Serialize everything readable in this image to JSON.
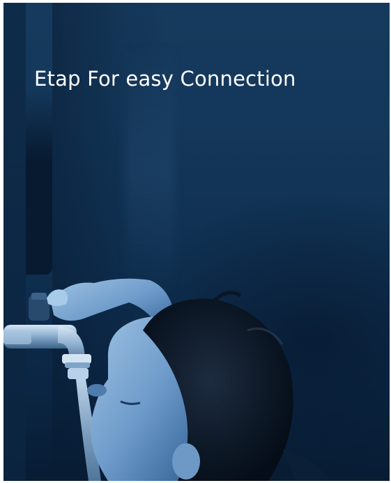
{
  "hero": {
    "headline": "Etap For easy Connection",
    "photo_subject": "child-drinking-from-tap",
    "colors": {
      "overlay_top": "#163a5d",
      "overlay_bottom": "#081c33",
      "text": "#ffffff"
    }
  }
}
